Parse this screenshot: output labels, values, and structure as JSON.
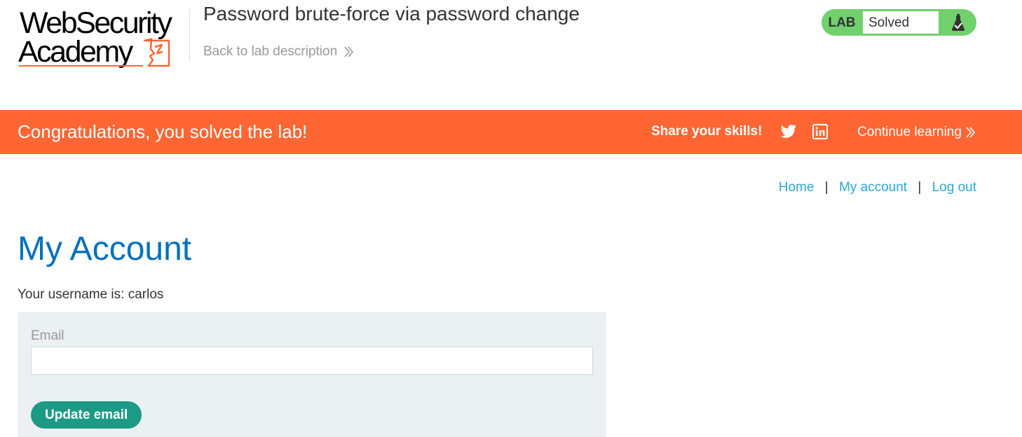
{
  "header": {
    "logo_line1": "WebSecurity",
    "logo_line2": "Academy",
    "lab_title": "Password brute-force via password change",
    "back_link": "Back to lab description",
    "lab_status": {
      "tag": "LAB",
      "value": "Solved"
    }
  },
  "banner": {
    "message": "Congratulations, you solved the lab!",
    "share_label": "Share your skills!",
    "continue_label": "Continue learning",
    "icons": [
      "twitter-icon",
      "linkedin-icon"
    ]
  },
  "nav": {
    "home": "Home",
    "my_account": "My account",
    "log_out": "Log out",
    "separator": "|"
  },
  "main": {
    "title": "My Account",
    "username_line": "Your username is: carlos",
    "email_label": "Email",
    "email_value": "",
    "update_button": "Update email"
  },
  "colors": {
    "banner": "#ff6633",
    "lab_status_green": "#70d16d",
    "link_blue": "#29a8dc",
    "title_blue": "#0071bc",
    "button_green": "#1b9a85",
    "panel_bg": "#ebf0f2",
    "logo_accent": "#ff6633"
  }
}
